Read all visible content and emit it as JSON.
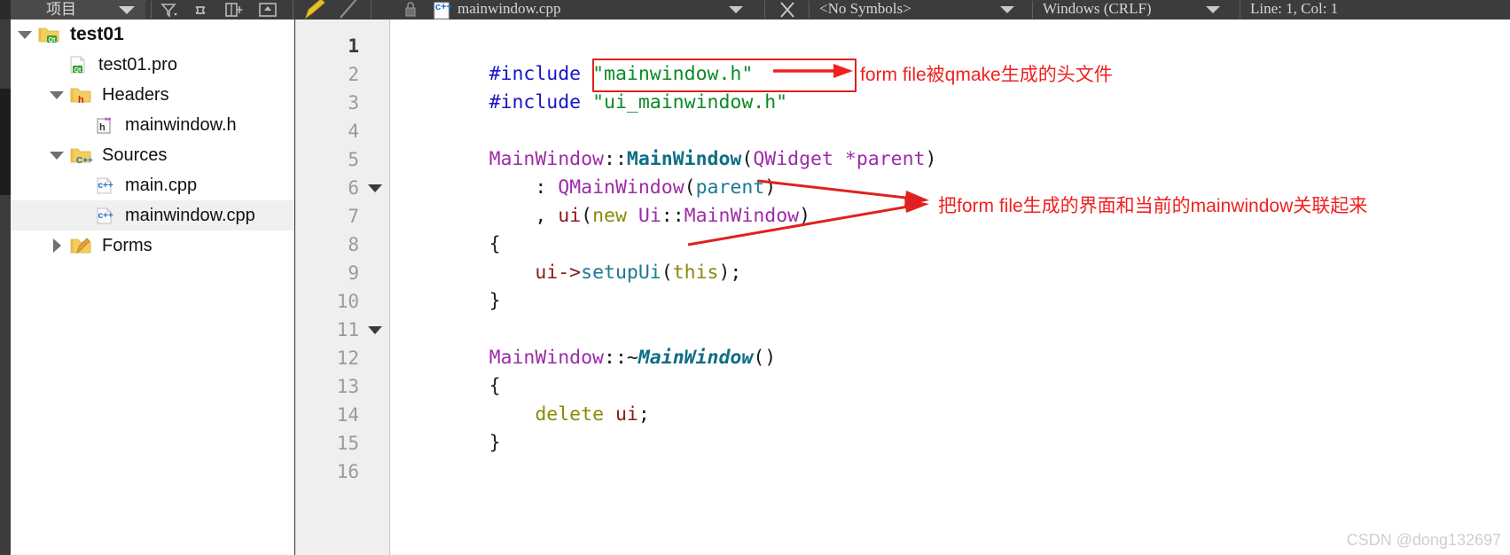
{
  "toolbar": {
    "project_combo_label": "项目",
    "project_combo_icon": "chevron-down-icon",
    "icons": [
      {
        "name": "filter-icon",
        "glyph": "filter"
      },
      {
        "name": "link-icon",
        "glyph": "link"
      },
      {
        "name": "split-add-icon",
        "glyph": "split-add"
      },
      {
        "name": "maximize-pane-icon",
        "glyph": "maximize-pane"
      },
      {
        "name": "pencil-icon",
        "glyph": "pencil"
      },
      {
        "name": "slash-icon",
        "glyph": "slash"
      }
    ],
    "file_tab": {
      "label": "mainwindow.cpp",
      "icon": "cpp-file-icon",
      "lock_icon": "lock-icon"
    },
    "close_icon": "close-icon",
    "symbols_combo": "<No Symbols>",
    "line_ending_combo": "Windows (CRLF)",
    "cursor_position": "Line: 1, Col: 1"
  },
  "sidebar": {
    "tree": [
      {
        "label": "test01",
        "icon": "qt-folder-icon",
        "arrow": "down",
        "depth": 0,
        "bold": true,
        "selected": false
      },
      {
        "label": "test01.pro",
        "icon": "qt-pro-file-icon",
        "arrow": "none",
        "depth": 1,
        "bold": false,
        "selected": false
      },
      {
        "label": "Headers",
        "icon": "h-folder-icon",
        "arrow": "down",
        "depth": 1,
        "bold": false,
        "selected": false
      },
      {
        "label": "mainwindow.h",
        "icon": "h-file-icon",
        "arrow": "none",
        "depth": 2,
        "bold": false,
        "selected": false
      },
      {
        "label": "Sources",
        "icon": "cpp-folder-icon",
        "arrow": "down",
        "depth": 1,
        "bold": false,
        "selected": false
      },
      {
        "label": "main.cpp",
        "icon": "cpp-file-icon",
        "arrow": "none",
        "depth": 2,
        "bold": false,
        "selected": false
      },
      {
        "label": "mainwindow.cpp",
        "icon": "cpp-file-icon",
        "arrow": "none",
        "depth": 2,
        "bold": false,
        "selected": true
      },
      {
        "label": "Forms",
        "icon": "forms-folder-icon",
        "arrow": "right",
        "depth": 1,
        "bold": false,
        "selected": false
      }
    ]
  },
  "editor": {
    "line_numbers": [
      "1",
      "2",
      "3",
      "4",
      "5",
      "6",
      "7",
      "8",
      "9",
      "10",
      "11",
      "12",
      "13",
      "14",
      "15",
      "16"
    ],
    "active_line_number": "1",
    "fold_markers_at_lines": [
      "6",
      "11"
    ],
    "lines": [
      {
        "n": "1",
        "text": "#include \"mainwindow.h\""
      },
      {
        "n": "2",
        "text": "#include \"ui_mainwindow.h\""
      },
      {
        "n": "3",
        "text": ""
      },
      {
        "n": "4",
        "text": "MainWindow::MainWindow(QWidget *parent)"
      },
      {
        "n": "5",
        "text": "    : QMainWindow(parent)"
      },
      {
        "n": "6",
        "text": "    , ui(new Ui::MainWindow)"
      },
      {
        "n": "7",
        "text": "{"
      },
      {
        "n": "8",
        "text": "    ui->setupUi(this);"
      },
      {
        "n": "9",
        "text": "}"
      },
      {
        "n": "10",
        "text": ""
      },
      {
        "n": "11",
        "text": "MainWindow::~MainWindow()"
      },
      {
        "n": "12",
        "text": "{"
      },
      {
        "n": "13",
        "text": "    delete ui;"
      },
      {
        "n": "14",
        "text": "}"
      },
      {
        "n": "15",
        "text": ""
      },
      {
        "n": "16",
        "text": ""
      }
    ],
    "tokens": {
      "inc_directive": "#include",
      "str_mainwindow_h": "\"mainwindow.h\"",
      "str_ui_mainwindow_h": "\"ui_mainwindow.h\"",
      "cls_mainwindow": "MainWindow",
      "scope": "::",
      "ctor_mainwindow": "MainWindow",
      "paren_open": "(",
      "paren_close": ")",
      "qwidget": "QWidget",
      "star_parent": "*parent",
      "colon": ":",
      "qmainwindow": "QMainWindow",
      "parent": "parent",
      "comma": ",",
      "ui": "ui",
      "kw_new": "new",
      "ui_ns": "Ui",
      "brace_open": "{",
      "brace_close": "}",
      "arrow_op": "->",
      "setup_ui": "setupUi",
      "kw_this": "this",
      "semicolon": ";",
      "tilde": "~",
      "kw_delete": "delete"
    },
    "highlight_box_target": "\"ui_mainwindow.h\""
  },
  "annotations": [
    {
      "name": "annotation-ui-header",
      "text": "form file被qmake生成的头文件",
      "color": "#f02020"
    },
    {
      "name": "annotation-setupui",
      "text": "把form file生成的界面和当前的mainwindow关联起来",
      "color": "#f02020"
    }
  ],
  "watermark": "CSDN @dong132697"
}
